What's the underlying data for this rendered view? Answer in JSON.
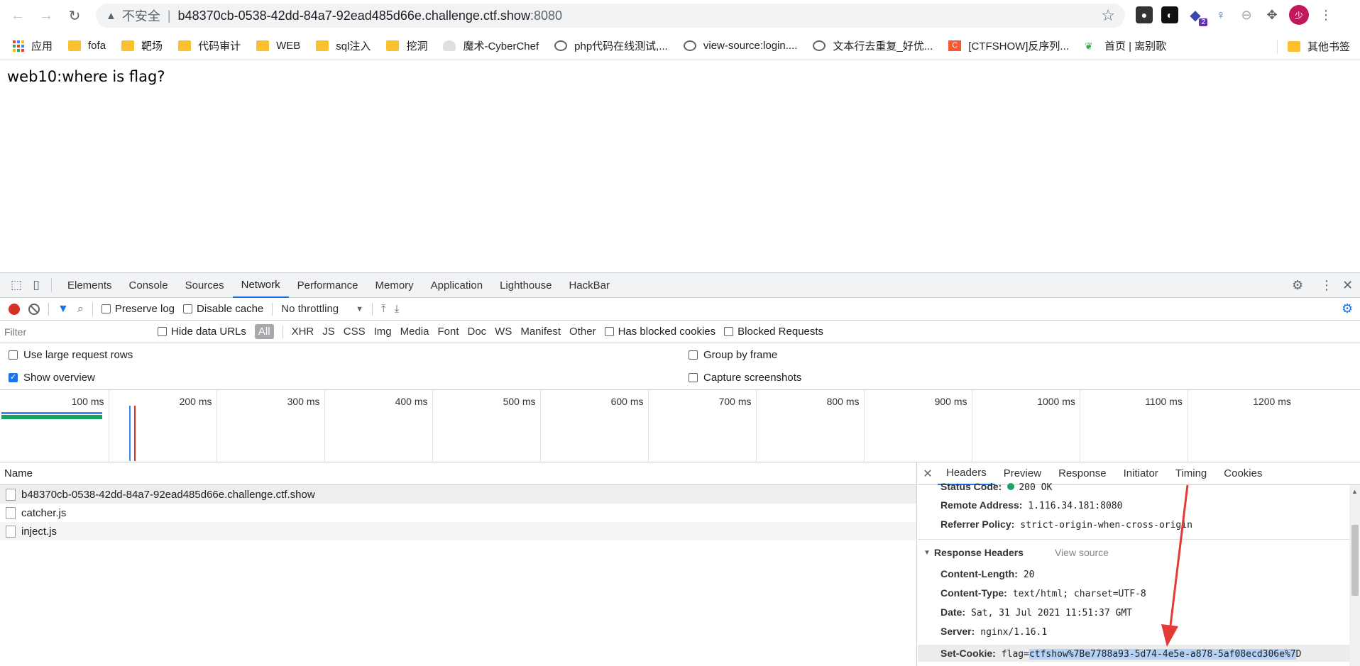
{
  "browser": {
    "security_label": "不安全",
    "url_host": "b48370cb-0538-42dd-84a7-92ead485d66e.challenge.ctf.show",
    "url_port": ":8080",
    "avatar_text": "少",
    "ext_badge": "2"
  },
  "bookmarks": {
    "items": [
      {
        "label": "应用",
        "icon": "apps-grid-icon"
      },
      {
        "label": "fofa",
        "icon": "folder-icon"
      },
      {
        "label": "靶场",
        "icon": "folder-icon"
      },
      {
        "label": "代码审计",
        "icon": "folder-icon"
      },
      {
        "label": "WEB",
        "icon": "folder-icon"
      },
      {
        "label": "sql注入",
        "icon": "folder-icon"
      },
      {
        "label": "挖洞",
        "icon": "folder-icon"
      },
      {
        "label": "魔术-CyberChef",
        "icon": "chef-icon"
      },
      {
        "label": "php代码在线测试,...",
        "icon": "globe-icon"
      },
      {
        "label": "view-source:login....",
        "icon": "globe-icon"
      },
      {
        "label": "文本行去重复_好优...",
        "icon": "globe-icon"
      },
      {
        "label": "[CTFSHOW]反序列...",
        "icon": "csdn-icon"
      },
      {
        "label": "首页 | 离别歌",
        "icon": "leaf-icon"
      }
    ],
    "other": "其他书签"
  },
  "page": {
    "text": "web10:where is flag?"
  },
  "devtools": {
    "tabs": [
      "Elements",
      "Console",
      "Sources",
      "Network",
      "Performance",
      "Memory",
      "Application",
      "Lighthouse",
      "HackBar"
    ],
    "active_tab": "Network",
    "toolbar": {
      "preserve_log": "Preserve log",
      "disable_cache": "Disable cache",
      "throttling": "No throttling"
    },
    "filter": {
      "placeholder": "Filter",
      "hide_data_urls": "Hide data URLs",
      "types": [
        "All",
        "XHR",
        "JS",
        "CSS",
        "Img",
        "Media",
        "Font",
        "Doc",
        "WS",
        "Manifest",
        "Other"
      ],
      "has_blocked_cookies": "Has blocked cookies",
      "blocked_requests": "Blocked Requests"
    },
    "options": {
      "large_rows": "Use large request rows",
      "show_overview": "Show overview",
      "group_by_frame": "Group by frame",
      "capture_screenshots": "Capture screenshots"
    },
    "overview_ticks": [
      "100 ms",
      "200 ms",
      "300 ms",
      "400 ms",
      "500 ms",
      "600 ms",
      "700 ms",
      "800 ms",
      "900 ms",
      "1000 ms",
      "1100 ms",
      "1200 ms"
    ],
    "requests": {
      "column": "Name",
      "rows": [
        "b48370cb-0538-42dd-84a7-92ead485d66e.challenge.ctf.show",
        "catcher.js",
        "inject.js"
      ]
    },
    "detail": {
      "tabs": [
        "Headers",
        "Preview",
        "Response",
        "Initiator",
        "Timing",
        "Cookies"
      ],
      "active_tab": "Headers",
      "general": [
        {
          "k": "Status Code:",
          "v": "200 OK"
        },
        {
          "k": "Remote Address:",
          "v": "1.116.34.181:8080"
        },
        {
          "k": "Referrer Policy:",
          "v": "strict-origin-when-cross-origin"
        }
      ],
      "response_headers_title": "Response Headers",
      "view_source": "View source",
      "response_headers": [
        {
          "k": "Content-Length:",
          "v": "20"
        },
        {
          "k": "Content-Type:",
          "v": "text/html; charset=UTF-8"
        },
        {
          "k": "Date:",
          "v": "Sat, 31 Jul 2021 11:51:37 GMT"
        },
        {
          "k": "Server:",
          "v": "nginx/1.16.1"
        }
      ],
      "set_cookie_key": "Set-Cookie:",
      "set_cookie_prefix": "flag=",
      "set_cookie_value": "ctfshow%7Be7788a93-5d74-4e5e-a878-5af08ecd306e%7",
      "set_cookie_suffix": "D"
    }
  },
  "colors": {
    "accent": "#1a73e8",
    "record": "#d93025",
    "success": "#1aa260",
    "annotation_arrow": "#e53935"
  }
}
